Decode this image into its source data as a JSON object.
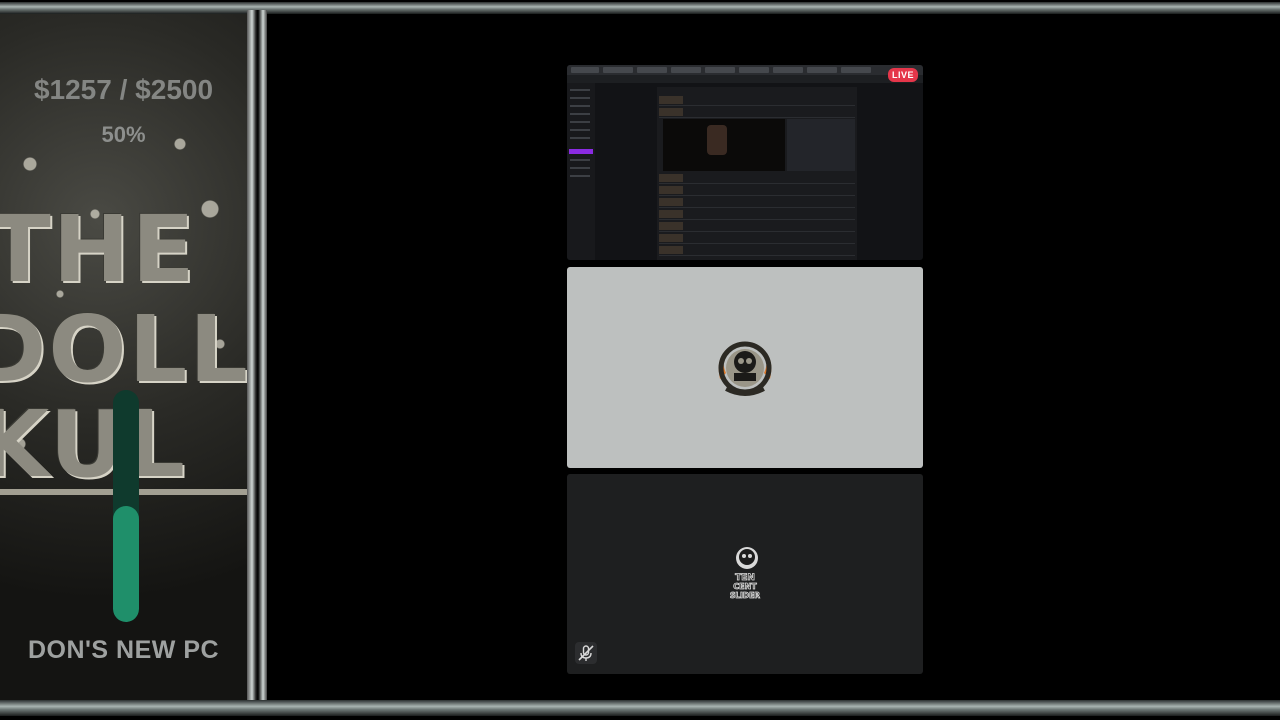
{
  "goal": {
    "amount": "$1257 / $2500",
    "percent_text": "50%",
    "progress": 0.5,
    "label": "DON'S NEW PC",
    "fill_color": "#1f8f6a"
  },
  "background_art": {
    "line1": "THE",
    "line2": "DOLL",
    "line3": "KUL"
  },
  "stream": {
    "live_badge": "LIVE"
  },
  "webcam_logos": {
    "cam2_text": "TEN CENT SLIDER"
  },
  "icons": {
    "mic_off": "mic-off-icon"
  },
  "colors": {
    "live": "#e5364a",
    "screen_bg": "#121316",
    "cam1_bg": "#bdc0bf",
    "cam2_bg": "#1e1f20"
  }
}
